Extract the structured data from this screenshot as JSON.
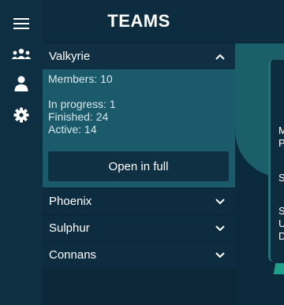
{
  "panel": {
    "title": "TEAMS"
  },
  "teams": [
    {
      "name": "Valkyrie",
      "expanded": true,
      "members": "Members: 10",
      "in_progress": "In progress: 1",
      "finished": "Finished: 24",
      "active": "Active: 14",
      "open_label": "Open in full"
    },
    {
      "name": "Phoenix",
      "expanded": false
    },
    {
      "name": "Sulphur",
      "expanded": false
    },
    {
      "name": "Connans",
      "expanded": false
    }
  ],
  "card": {
    "lines": [
      "M",
      "P",
      "S",
      "S",
      "U",
      "D"
    ]
  },
  "icons": {
    "menu": "hamburger-icon",
    "teams": "group-icon",
    "profile": "user-icon",
    "settings": "gear-icon"
  }
}
